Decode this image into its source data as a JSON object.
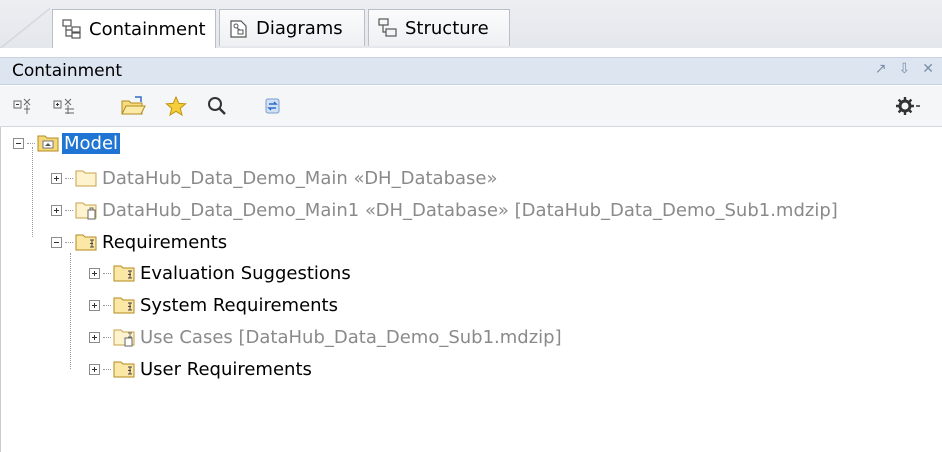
{
  "tabs": [
    {
      "label": "Containment",
      "icon": "containment-tree-icon",
      "active": true
    },
    {
      "label": "Diagrams",
      "icon": "diagrams-icon",
      "active": false
    },
    {
      "label": "Structure",
      "icon": "structure-icon",
      "active": false
    }
  ],
  "panel": {
    "title": "Containment",
    "controls": [
      "float-icon",
      "pin-icon",
      "close-icon"
    ]
  },
  "toolbar": {
    "buttons": [
      "collapse-all-icon",
      "expand-all-icon",
      "open-folder-icon",
      "favorites-star-icon",
      "search-icon",
      "refresh-icon",
      "settings-gear-icon"
    ]
  },
  "tree": [
    {
      "label": "Model",
      "state": "expanded",
      "selected": true,
      "grey": false,
      "icon": "model-package-icon"
    },
    {
      "label": "DataHub_Data_Demo_Main «DH_Database»",
      "state": "collapsed",
      "selected": false,
      "grey": true,
      "icon": "package-folder-icon"
    },
    {
      "label": "DataHub_Data_Demo_Main1 «DH_Database» [DataHub_Data_Demo_Sub1.mdzip]",
      "state": "collapsed",
      "selected": false,
      "grey": true,
      "icon": "shared-package-icon"
    },
    {
      "label": "Requirements",
      "state": "expanded",
      "selected": false,
      "grey": false,
      "icon": "requirements-folder-icon"
    },
    {
      "label": "Evaluation Suggestions",
      "state": "collapsed",
      "selected": false,
      "grey": false,
      "icon": "requirements-folder-icon"
    },
    {
      "label": "System Requirements",
      "state": "collapsed",
      "selected": false,
      "grey": false,
      "icon": "requirements-folder-icon"
    },
    {
      "label": "Use Cases [DataHub_Data_Demo_Sub1.mdzip]",
      "state": "collapsed",
      "selected": false,
      "grey": true,
      "icon": "shared-requirements-folder-icon"
    },
    {
      "label": "User Requirements",
      "state": "collapsed",
      "selected": false,
      "grey": false,
      "icon": "requirements-folder-icon"
    }
  ],
  "colors": {
    "selection": "#1f74d4",
    "folder": "#f3d97a",
    "panel_header": "#dde5f0"
  }
}
